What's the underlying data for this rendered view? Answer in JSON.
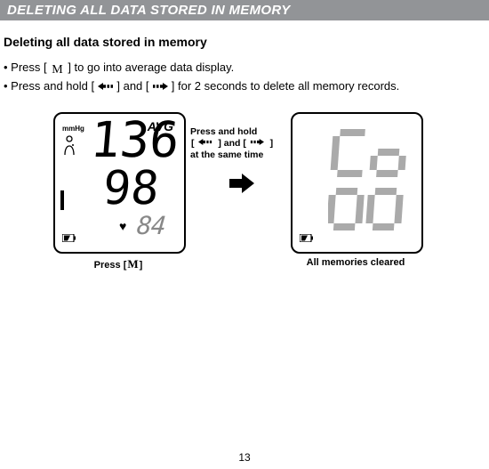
{
  "title_bar": "DELETING ALL DATA STORED IN MEMORY",
  "subhead": "Deleting all data stored in memory",
  "steps": {
    "s1_a": "• Press [",
    "s1_m": "M",
    "s1_b": "] to go into average data display.",
    "s2_a": "• Press and hold [",
    "s2_b": "] and [",
    "s2_c": "] for 2 seconds to delete all memory records."
  },
  "left_lcd": {
    "avg": "AVG",
    "unit": "mmHg",
    "sys": "136",
    "dia": "98",
    "pulse": "84"
  },
  "right_lcd": {
    "top": "Co",
    "bot": "oo"
  },
  "mid": {
    "l1": "Press and hold",
    "l2_a": "[ ",
    "l2_b": " ] and [ ",
    "l2_c": " ]",
    "l3": "at the same time"
  },
  "cap_left_a": "Press  [",
  "cap_left_m": "M",
  "cap_left_b": "]",
  "cap_right": "All memories cleared",
  "page": "13"
}
